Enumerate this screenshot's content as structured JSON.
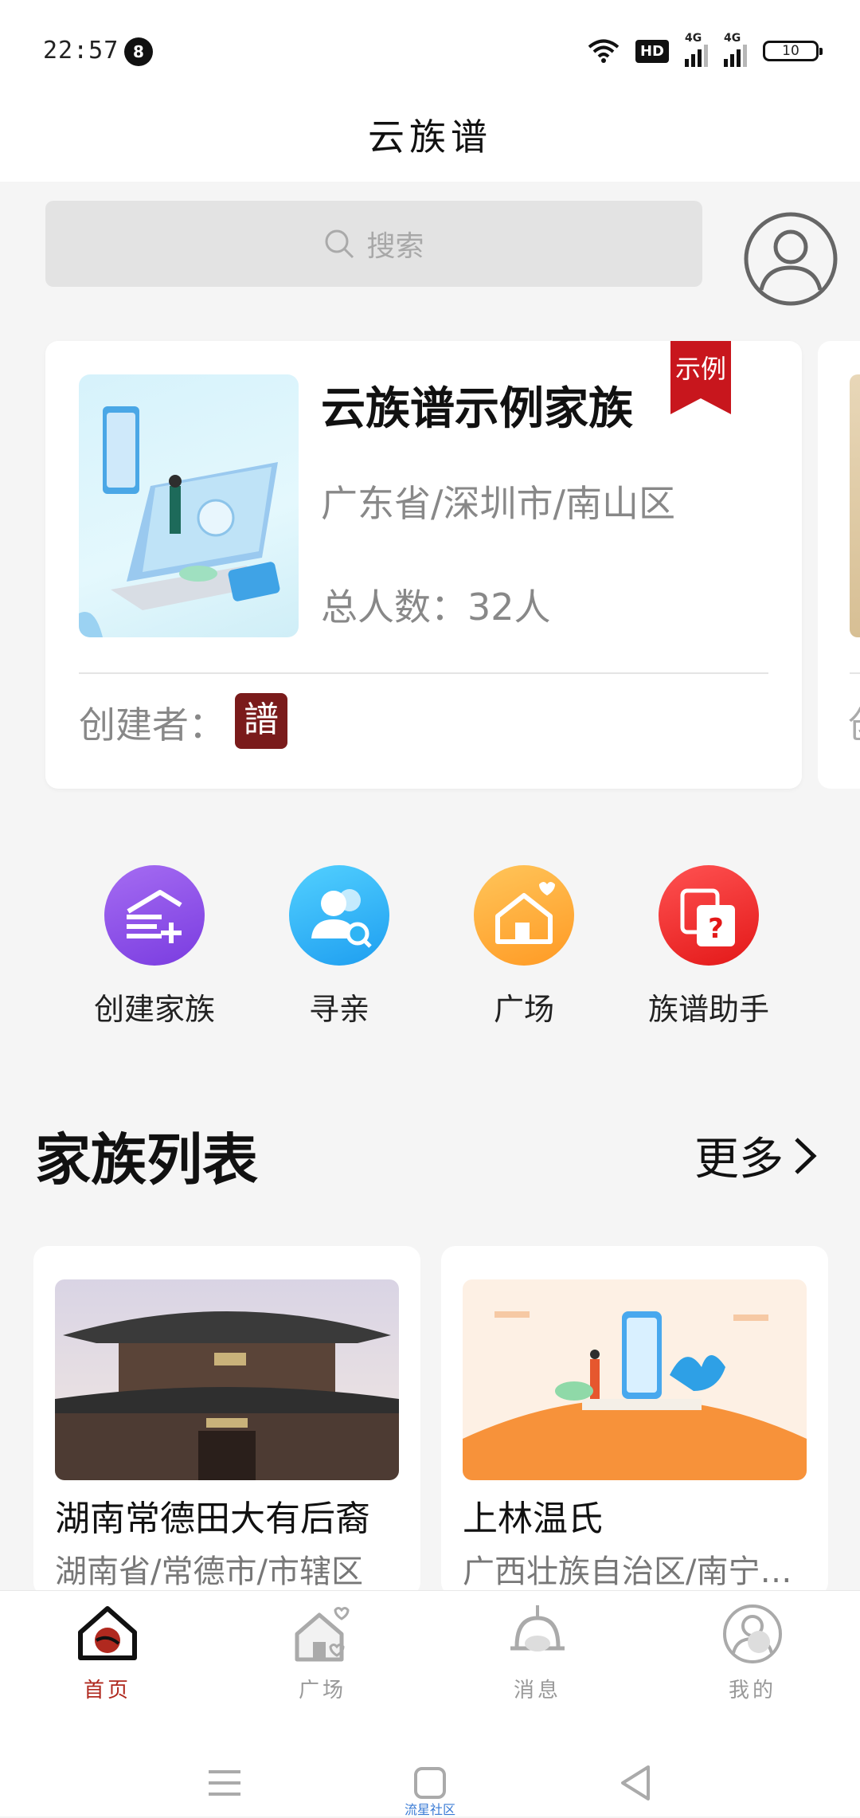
{
  "status_bar": {
    "time": "22:57",
    "notification_count": "8",
    "hd_label": "HD",
    "signal_1_label": "4G",
    "signal_2_label": "4G",
    "battery_level": "10"
  },
  "header": {
    "title": "云族谱"
  },
  "search": {
    "placeholder": "搜索"
  },
  "featured_family": {
    "name": "云族谱示例家族",
    "location": "广东省/深圳市/南山区",
    "member_count": "总人数：32人",
    "ribbon_label": "示例",
    "creator_label": "创建者：",
    "creator_seal_char": "譜",
    "peek_creator_char": "创"
  },
  "quick_actions": [
    {
      "label": "创建家族",
      "color": "#8a4fe8"
    },
    {
      "label": "寻亲",
      "color": "#2fb4f4"
    },
    {
      "label": "广场",
      "color": "#ffad3a"
    },
    {
      "label": "族谱助手",
      "color": "#f52f2f"
    }
  ],
  "family_list": {
    "title": "家族列表",
    "more_label": "更多",
    "items": [
      {
        "name": "湖南常德田大有后裔",
        "location": "湖南省/常德市/市辖区"
      },
      {
        "name": "上林温氏",
        "location": "广西壮族自治区/南宁…"
      }
    ]
  },
  "bottom_nav": {
    "active_color": "#b0291f",
    "items": [
      {
        "label": "首页",
        "icon": "home-icon",
        "active": true
      },
      {
        "label": "广场",
        "icon": "plaza-icon",
        "active": false
      },
      {
        "label": "消息",
        "icon": "bell-icon",
        "active": false
      },
      {
        "label": "我的",
        "icon": "user-icon",
        "active": false
      }
    ]
  },
  "system_nav": {
    "watermark": "流星社区"
  }
}
